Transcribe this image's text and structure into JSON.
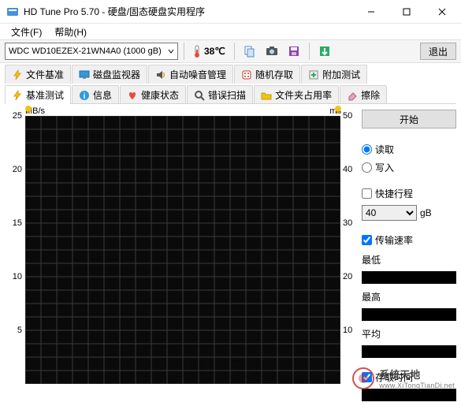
{
  "window": {
    "title": "HD Tune Pro 5.70 - 硬盘/固态硬盘实用程序"
  },
  "menu": {
    "file": "文件(F)",
    "help": "帮助(H)"
  },
  "toolbar": {
    "drive": "WDC WD10EZEX-21WN4A0 (1000 gB)",
    "temp": "38℃",
    "exit": "退出"
  },
  "tabs_row1": [
    {
      "label": "文件基准",
      "icon": "lightning"
    },
    {
      "label": "磁盘监视器",
      "icon": "monitor"
    },
    {
      "label": "自动噪音管理",
      "icon": "speaker"
    },
    {
      "label": "随机存取",
      "icon": "dice"
    },
    {
      "label": "附加测试",
      "icon": "plus"
    }
  ],
  "tabs_row2": [
    {
      "label": "基准测试",
      "icon": "lightning",
      "active": true
    },
    {
      "label": "信息",
      "icon": "info"
    },
    {
      "label": "健康状态",
      "icon": "heart"
    },
    {
      "label": "错误扫描",
      "icon": "search"
    },
    {
      "label": "文件夹占用率",
      "icon": "folder"
    },
    {
      "label": "擦除",
      "icon": "eraser"
    }
  ],
  "chart_data": {
    "type": "line",
    "title": "",
    "xlabel": "",
    "ylabel_left": "MB/s",
    "ylabel_right": "ms",
    "ylim": [
      0,
      25
    ],
    "yticks": [
      5,
      10,
      15,
      20,
      25
    ],
    "rlim": [
      0,
      50
    ],
    "rticks": [
      10,
      20,
      30,
      40,
      50
    ],
    "series": []
  },
  "side": {
    "start": "开始",
    "radio_read": "读取",
    "radio_write": "写入",
    "chk_short": "快捷行程",
    "size_val": "40",
    "size_unit": "gB",
    "chk_transfer": "传输速率",
    "min": "最低",
    "max": "最高",
    "avg": "平均",
    "chk_access": "存取时间"
  },
  "watermark": {
    "name": "系统天地",
    "url": "www.XiTongTianDi.net"
  }
}
